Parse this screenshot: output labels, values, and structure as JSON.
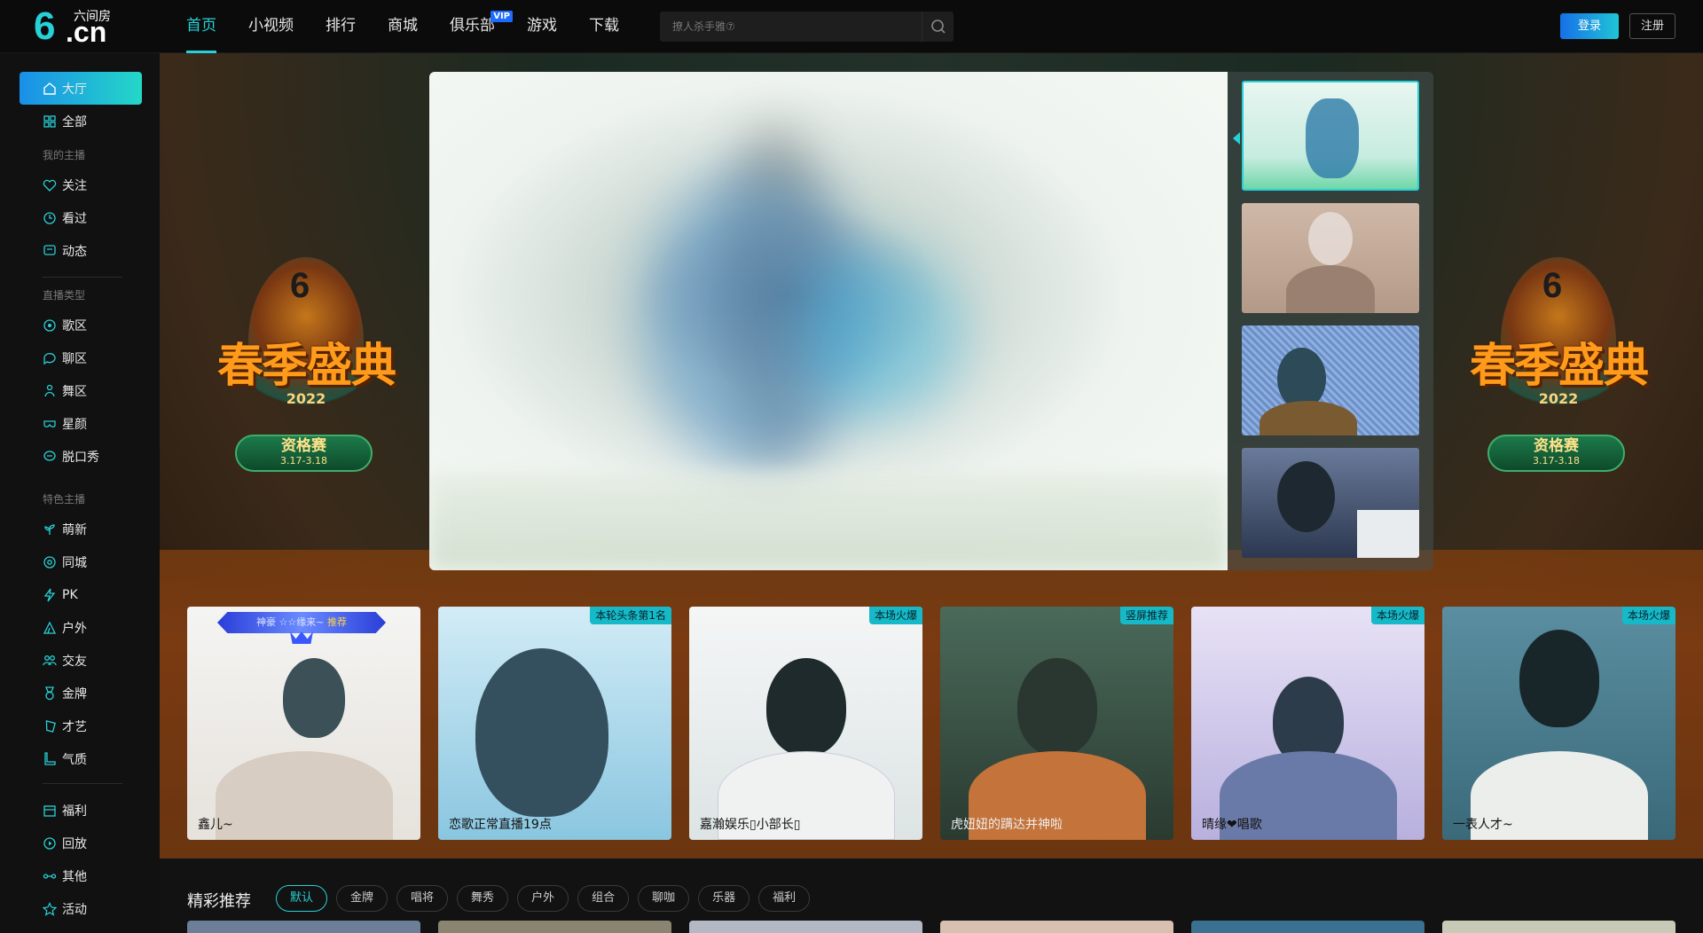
{
  "brand": {
    "logo_six": "6",
    "logo_cn": ".cn",
    "name": "六间房"
  },
  "nav": [
    {
      "label": "首页",
      "active": true
    },
    {
      "label": "小视频"
    },
    {
      "label": "排行"
    },
    {
      "label": "商城"
    },
    {
      "label": "俱乐部",
      "badge": "VIP"
    },
    {
      "label": "游戏"
    },
    {
      "label": "下载"
    }
  ],
  "search": {
    "placeholder": "撩人杀手雅⑦"
  },
  "auth": {
    "login": "登录",
    "register": "注册"
  },
  "sidebar": {
    "items": [
      {
        "label": "大厅",
        "icon": "home-icon",
        "active": true
      },
      {
        "label": "全部",
        "icon": "grid-icon"
      }
    ],
    "my_header": "我的主播",
    "my_items": [
      {
        "label": "关注",
        "icon": "heart-icon"
      },
      {
        "label": "看过",
        "icon": "clock-icon"
      },
      {
        "label": "动态",
        "icon": "chat-icon"
      }
    ],
    "type_header": "直播类型",
    "type_items": [
      {
        "label": "歌区",
        "icon": "music-icon"
      },
      {
        "label": "聊区",
        "icon": "bubble-icon"
      },
      {
        "label": "舞区",
        "icon": "dance-icon"
      },
      {
        "label": "星颜",
        "icon": "mask-icon"
      },
      {
        "label": "脱口秀",
        "icon": "mic-icon"
      }
    ],
    "feature_header": "特色主播",
    "feature_items": [
      {
        "label": "萌新",
        "icon": "sprout-icon"
      },
      {
        "label": "同城",
        "icon": "location-icon"
      },
      {
        "label": "PK",
        "icon": "bolt-icon"
      },
      {
        "label": "户外",
        "icon": "tent-icon"
      },
      {
        "label": "交友",
        "icon": "people-icon"
      },
      {
        "label": "金牌",
        "icon": "medal-icon"
      },
      {
        "label": "才艺",
        "icon": "palette-icon"
      },
      {
        "label": "气质",
        "icon": "boot-icon"
      }
    ],
    "extra_items": [
      {
        "label": "福利",
        "icon": "gift-icon"
      },
      {
        "label": "回放",
        "icon": "replay-icon"
      },
      {
        "label": "其他",
        "icon": "dots-icon"
      },
      {
        "label": "活动",
        "icon": "star-icon"
      }
    ]
  },
  "banner": {
    "title": "春季盛典",
    "year": "2022",
    "badge_title": "资格赛",
    "badge_dates": "3.17-3.18"
  },
  "cards": [
    {
      "name": "鑫儿~",
      "badge": "",
      "ribbon": "神豪 ☆☆缘来~",
      "ribbon_tag": "推荐",
      "colors": [
        "#f2f2f0",
        "#d8ccc2",
        "#39505a"
      ]
    },
    {
      "name": "恋歌正常直播19点",
      "badge": "本轮头条第1名",
      "colors": [
        "#b9e3f2",
        "#2d3f4a",
        "#4a7fa8"
      ]
    },
    {
      "name": "嘉瀚娱乐▯小部长▯",
      "badge": "本场火爆",
      "colors": [
        "#e2e8e8",
        "#1e2b2c",
        "#8a9a98"
      ]
    },
    {
      "name": "虎妞妞的蹒达并神啦",
      "badge": "竖屏推荐",
      "colors": [
        "#6a8a7a",
        "#2d3a32",
        "#c4733a"
      ]
    },
    {
      "name": "晴缘❤唱歌",
      "badge": "本场火爆",
      "colors": [
        "#d8d2ee",
        "#2a3a48",
        "#7a8ac8"
      ]
    },
    {
      "name": "一表人才~",
      "badge": "本场火爆",
      "colors": [
        "#5a8a9a",
        "#1a2a2e",
        "#e8ecea"
      ]
    }
  ],
  "recommend": {
    "title": "精彩推荐",
    "tabs": [
      "默认",
      "金牌",
      "唱将",
      "舞秀",
      "户外",
      "组合",
      "聊咖",
      "乐器",
      "福利"
    ]
  },
  "colors": {
    "accent": "#27d1d7",
    "login_gradient_start": "#1670e8",
    "login_gradient_end": "#20c5d6",
    "sidebar_bg": "#111111"
  }
}
